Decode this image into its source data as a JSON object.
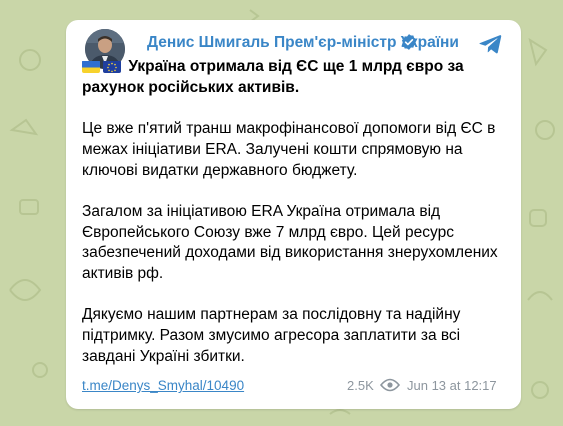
{
  "channel": {
    "name": "Денис Шмигаль Прем'єр-міністр України",
    "verified_icon": "verified-badge-icon",
    "share_icon": "telegram-share-icon"
  },
  "post": {
    "flags": [
      "ukraine-flag-icon",
      "eu-flag-icon"
    ],
    "headline": "Україна отримала від ЄС ще 1 млрд євро за рахунок російських активів.",
    "paragraphs": [
      "Це вже п'ятий транш макрофінансової допомоги від ЄС в межах ініціативи ERA. Залучені кошти спрямовую на ключові видатки державного бюджету.",
      "Загалом за ініціативою ERA Україна отримала від Європейського Союзу вже 7 млрд євро. Цей ресурс забезпечений доходами від використання знерухомлених активів рф.",
      "Дякуємо нашим партнерам за послідовну та надійну підтримку. Разом змусимо агресора заплатити за всі завдані Україні збитки."
    ]
  },
  "footer": {
    "link": "t.me/Denys_Smyhal/10490",
    "views": "2.5K",
    "date": "Jun 13 at 12:17"
  },
  "colors": {
    "accent": "#3a86c7",
    "background": "#c9d6a8",
    "muted": "#8d969e"
  }
}
